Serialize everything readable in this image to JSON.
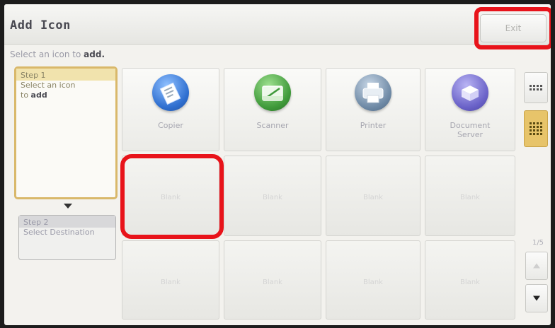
{
  "header": {
    "title": "Add Icon",
    "exit_label": "Exit"
  },
  "instruction": {
    "prefix": "Select an icon to ",
    "emphasis": "add."
  },
  "steps": {
    "step1": {
      "heading": "Step 1",
      "line1": "Select an icon",
      "line2_prefix": "to ",
      "line2_emphasis": "add"
    },
    "step2": {
      "heading": "Step 2",
      "line1": "Select Destination"
    }
  },
  "apps": [
    {
      "label": "Copier",
      "icon": "copier-icon",
      "color": "#2f6fd0"
    },
    {
      "label": "Scanner",
      "icon": "scanner-icon",
      "color": "#3f9a3a"
    },
    {
      "label": "Printer",
      "icon": "printer-icon",
      "color": "#6f8aa6"
    },
    {
      "label_line1": "Document",
      "label_line2": "Server",
      "icon": "document-server-icon",
      "color": "#6a62c8"
    }
  ],
  "blank_label": "Blank",
  "pagination": {
    "indicator": "1/5"
  },
  "highlight_color": "#e8131a",
  "accent_color": "#e7c46a"
}
